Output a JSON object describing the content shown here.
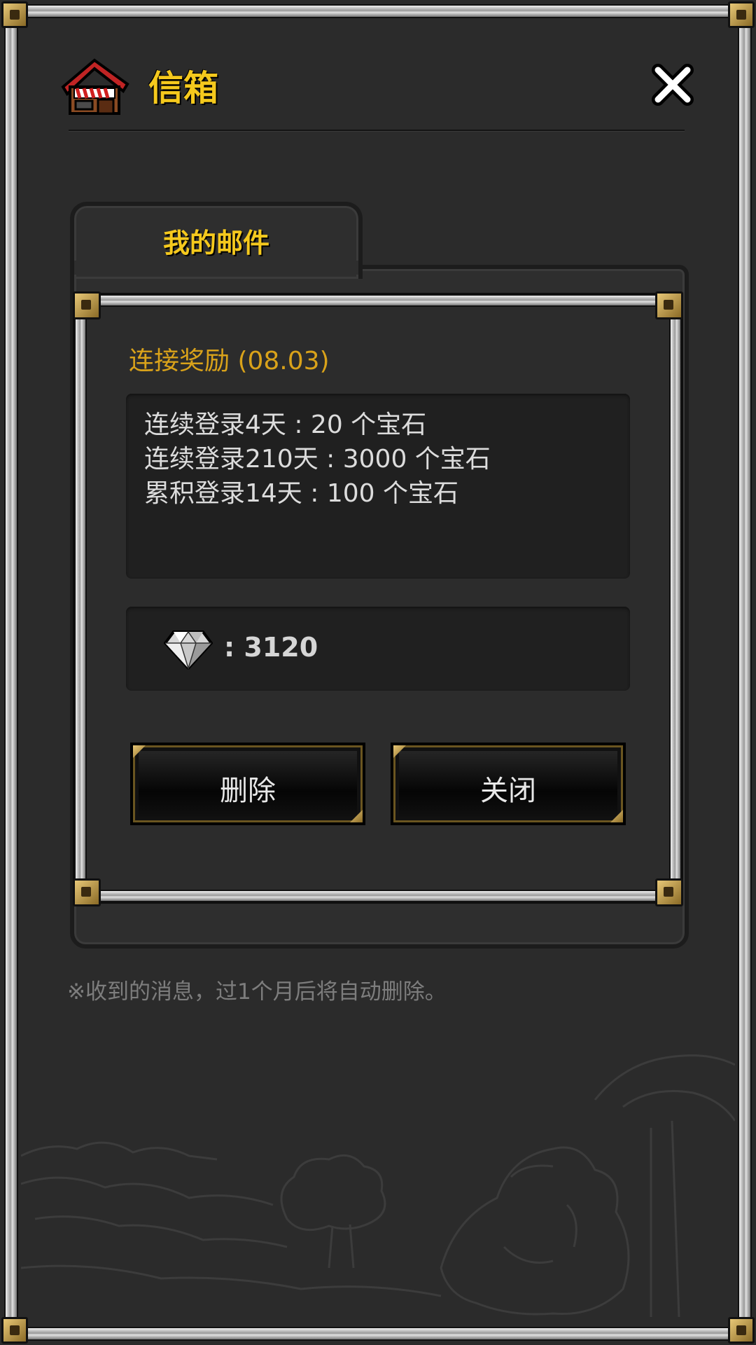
{
  "header": {
    "title": "信箱",
    "icon": "shop-house-icon",
    "close_icon": "close-icon"
  },
  "tabs": [
    {
      "label": "我的邮件",
      "active": true
    }
  ],
  "message": {
    "title": "连接奖励 (08.03)",
    "body_lines": [
      "连续登录4天 : 20 个宝石",
      "连续登录210天 : 3000 个宝石",
      "累积登录14天 : 100 个宝石"
    ],
    "reward": {
      "icon": "gem-icon",
      "text": ": 3120"
    }
  },
  "buttons": {
    "delete_label": "删除",
    "close_label": "关闭"
  },
  "footnote": "※收到的消息，过1个月后将自动删除。",
  "colors": {
    "accent_gold": "#f5c91d",
    "title_orange": "#d9a21a",
    "background": "#2b2b2b"
  }
}
